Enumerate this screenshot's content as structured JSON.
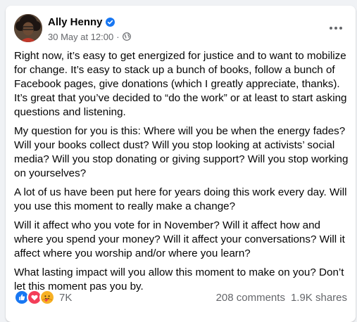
{
  "post": {
    "author": "Ally Henny",
    "timestamp": "30 May at 12:00",
    "separator": "·",
    "paragraphs": [
      "Right now, it’s easy to get energized for justice and to want to mobilize for change. It’s easy to stack up a bunch of books, follow a bunch of Facebook pages, give donations (which I greatly appreciate, thanks). It’s great that you’ve decided to “do the work” or at least to start asking questions and listening.",
      "My question for you is this: Where will you be when the energy fades? Will your books collect dust? Will you stop looking at activists’ social media? Will you stop donating or giving support? Will you stop working on yourselves?",
      "A lot of us have been put here for years doing this work every day. Will you use this moment to really make a change?",
      "Will it affect who you vote for in November? Will it affect how and where you spend your money? Will it affect your conversations? Will it affect where you worship and/or where you learn?",
      "What lasting impact will you allow this moment to make on you? Don’t let this moment pas you by."
    ]
  },
  "footer": {
    "reaction_count": "7K",
    "comments": "208 comments",
    "shares": "1.9K shares"
  },
  "icons": {
    "verified": "verified-badge-icon",
    "audience": "globe-icon",
    "more": "more-options-icon",
    "reactions": [
      "like-reaction-icon",
      "love-reaction-icon",
      "care-reaction-icon"
    ]
  },
  "colors": {
    "brand_blue": "#1877f2",
    "love_red": "#f33e58",
    "care_yellow": "#f7b125",
    "secondary_text": "#65676b",
    "page_background": "#f0f2f5"
  }
}
